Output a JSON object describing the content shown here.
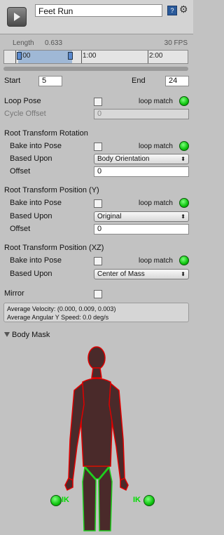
{
  "header": {
    "clip_name": "Feet Run"
  },
  "timeline": {
    "length_label": "Length",
    "length_value": "0.633",
    "fps": "30 FPS",
    "ticks": [
      "0:00",
      "1:00",
      "2:00"
    ]
  },
  "range": {
    "start_label": "Start",
    "start_value": "5",
    "end_label": "End",
    "end_value": "24"
  },
  "loop_pose": {
    "label": "Loop Pose",
    "loop_match": "loop match"
  },
  "cycle_offset": {
    "label": "Cycle Offset",
    "value": "0"
  },
  "rotation": {
    "title": "Root Transform Rotation",
    "bake_label": "Bake into Pose",
    "loop_match": "loop match",
    "based_label": "Based Upon",
    "based_value": "Body Orientation",
    "offset_label": "Offset",
    "offset_value": "0"
  },
  "position_y": {
    "title": "Root Transform Position (Y)",
    "bake_label": "Bake into Pose",
    "loop_match": "loop match",
    "based_label": "Based Upon",
    "based_value": "Original",
    "offset_label": "Offset",
    "offset_value": "0"
  },
  "position_xz": {
    "title": "Root Transform Position (XZ)",
    "bake_label": "Bake into Pose",
    "loop_match": "loop match",
    "based_label": "Based Upon",
    "based_value": "Center of Mass"
  },
  "mirror": {
    "label": "Mirror"
  },
  "info": {
    "velocity": "Average Velocity: (0.000, 0.009, 0.003)",
    "angular": "Average Angular Y Speed: 0.0 deg/s"
  },
  "body_mask": {
    "label": "Body Mask",
    "ik_left": "IK",
    "ik_right": "IK"
  },
  "colors": {
    "accent_green": "#0ec40e",
    "mask_red": "#e00000",
    "body_fill": "#4a2a2a"
  },
  "icons": [
    "clip-icon",
    "help-icon",
    "gear-icon",
    "foldout-arrow-icon",
    "dropdown-arrow-icon"
  ]
}
